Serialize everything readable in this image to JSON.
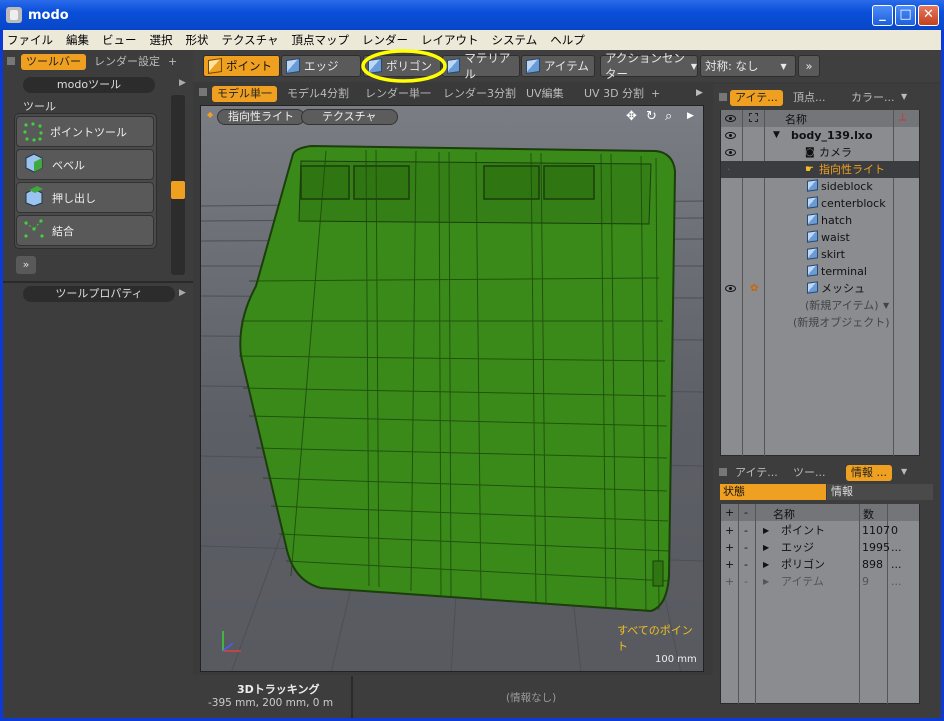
{
  "window": {
    "title": "modo"
  },
  "menu": [
    "ファイル",
    "編集",
    "ビュー",
    "選択",
    "形状",
    "テクスチャ",
    "頂点マップ",
    "レンダー",
    "レイアウト",
    "システム",
    "ヘルプ"
  ],
  "left_tabs": {
    "tab1": "ツールバー",
    "tab2": "レンダー設定"
  },
  "modo_tools": {
    "header": "modoツール",
    "section": "ツール",
    "tools": [
      "ポイントツール",
      "ベベル",
      "押し出し",
      "結合"
    ],
    "more": "»"
  },
  "tool_properties": {
    "header": "ツールプロパティ"
  },
  "toolbar": {
    "point": "ポイント",
    "edge": "エッジ",
    "polygon": "ポリゴン",
    "material": "マテリアル",
    "item": "アイテム",
    "action_center": "アクションセンター",
    "symmetry": "対称: なし",
    "more": "»"
  },
  "view_tabs": [
    "モデル単一",
    "モデル4分割",
    "レンダー単一",
    "レンダー3分割",
    "UV編集",
    "UV 3D 分割"
  ],
  "view_tabs_add": "+",
  "viewport": {
    "light_button": "指向性ライト",
    "texture_button": "テクスチャ",
    "selection_label": "すべてのポイント",
    "scale_label": "100 mm"
  },
  "status": {
    "title": "3Dトラッキング",
    "coords": "-395 mm, 200 mm, 0 m",
    "info": "(情報なし)"
  },
  "items_panel": {
    "tabs": [
      "アイテ...",
      "頂点...",
      "カラー..."
    ],
    "header_name": "名称",
    "rows": [
      {
        "label": "body_139.lxo",
        "visible": true
      },
      {
        "label": "カメラ",
        "visible": true
      },
      {
        "label": "指向性ライト",
        "visible": false,
        "selected": true
      },
      {
        "label": "sideblock"
      },
      {
        "label": "centerblock"
      },
      {
        "label": "hatch"
      },
      {
        "label": "waist"
      },
      {
        "label": "skirt"
      },
      {
        "label": "terminal"
      },
      {
        "label": "メッシュ",
        "visible": true
      },
      {
        "label": "(新規アイテム)"
      },
      {
        "label": "(新規オブジェクト)"
      }
    ]
  },
  "info_panel": {
    "tabs": [
      "アイテ...",
      "ツー...",
      "情報 ..."
    ],
    "subtabs": {
      "state": "状態",
      "info": "情報"
    },
    "columns": {
      "name": "名称",
      "count": "数"
    },
    "rows": [
      {
        "label": "ポイント",
        "count": "1107",
        "extra": "0"
      },
      {
        "label": "エッジ",
        "count": "1995",
        "extra": "..."
      },
      {
        "label": "ポリゴン",
        "count": "898",
        "extra": "..."
      },
      {
        "label": "アイテム",
        "count": "9",
        "extra": "..."
      }
    ]
  },
  "colors": {
    "accent": "#f0a020",
    "mesh": "#3a8a1a",
    "highlight": "#ffff00"
  }
}
